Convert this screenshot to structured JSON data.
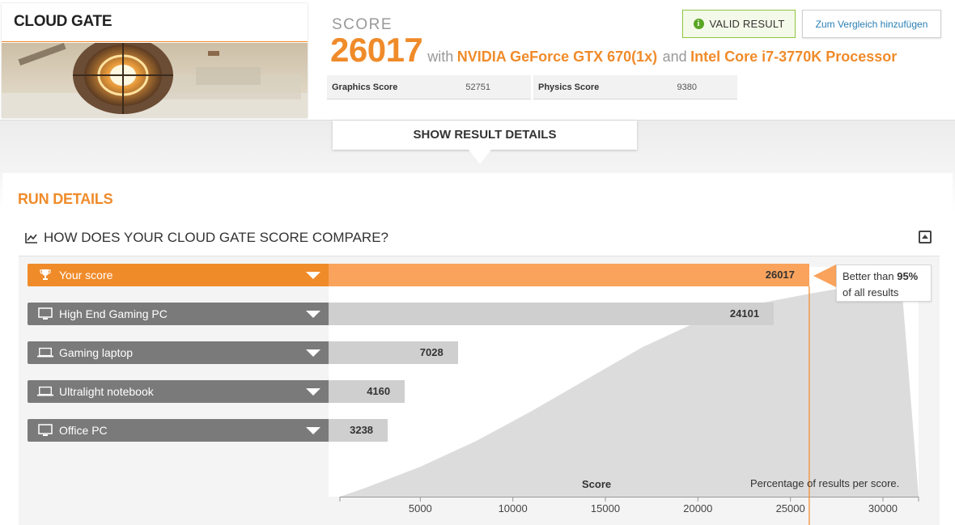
{
  "benchmark": {
    "title": "CLOUD GATE"
  },
  "score": {
    "label": "SCORE",
    "value": "26017",
    "with": "with",
    "gpu": "NVIDIA GeForce GTX 670(1x)",
    "and": "and",
    "cpu": "Intel Core i7-3770K Processor"
  },
  "subscores": [
    {
      "name": "Graphics Score",
      "value": "52751"
    },
    {
      "name": "Physics Score",
      "value": "9380"
    }
  ],
  "actions": {
    "valid_result": "VALID RESULT",
    "compare": "Zum Vergleich hinzufügen",
    "show_details": "SHOW RESULT DETAILS"
  },
  "run_details": {
    "title": "RUN DETAILS",
    "compare_title": "HOW DOES YOUR CLOUD GATE SCORE COMPARE?"
  },
  "tooltip": {
    "prefix": "Better than ",
    "percent": "95%",
    "suffix": "of all results"
  },
  "colors": {
    "accent": "#f08b2a",
    "accent_light": "#f9a35c",
    "valid": "#8cc63f",
    "link": "#2a7fb4"
  },
  "chart_data": {
    "type": "bar",
    "categories": [
      "Your score",
      "High End Gaming PC",
      "Gaming laptop",
      "Ultralight notebook",
      "Office PC"
    ],
    "icons": [
      "trophy-icon",
      "desktop-icon",
      "laptop-icon",
      "laptop-icon",
      "desktop-icon"
    ],
    "values": [
      26017,
      24101,
      7028,
      4160,
      3238
    ],
    "value_labels": [
      "26017",
      "24101",
      "7028",
      "4160",
      "3238"
    ],
    "xlabel": "Score",
    "distribution_note": "Percentage of results per score.",
    "xlim": [
      0,
      32000
    ],
    "x_ticks": [
      5000,
      10000,
      15000,
      20000,
      25000,
      30000
    ],
    "x_tick_labels": [
      "5000",
      "10000",
      "15000",
      "20000",
      "25000",
      "30000"
    ],
    "distribution": {
      "x": [
        0,
        2000,
        5000,
        8000,
        11000,
        14000,
        17000,
        20000,
        23000,
        26000,
        28000,
        31000
      ],
      "y": [
        0,
        4,
        14,
        26,
        40,
        55,
        70,
        82,
        90,
        95,
        98,
        100
      ]
    },
    "marker_value": 26017
  }
}
